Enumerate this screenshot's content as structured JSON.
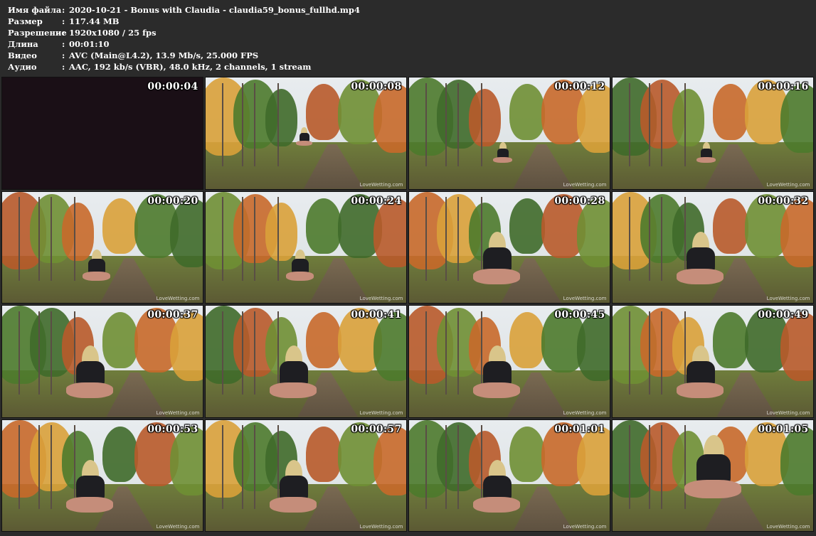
{
  "info": [
    {
      "key": "Имя файла",
      "value": "2020-10-21 - Bonus with Claudia - claudia59_bonus_fullhd.mp4"
    },
    {
      "key": "Размер",
      "value": "117.44 MB"
    },
    {
      "key": "Разрешение",
      "value": "1920x1080 / 25 fps"
    },
    {
      "key": "Длина",
      "value": "00:01:10"
    },
    {
      "key": "Видео",
      "value": "AVC (Main@L4.2), 13.9 Mb/s, 25.000 FPS"
    },
    {
      "key": "Аудио",
      "value": "AAC, 192 kb/s (VBR), 48.0 kHz, 2 channels, 1 stream"
    }
  ],
  "separator": ":",
  "watermark": "LoveWetting.com",
  "thumbnails": [
    {
      "time": "00:00:04",
      "scene": "dark"
    },
    {
      "time": "00:00:08",
      "scene": "standing-far"
    },
    {
      "time": "00:00:12",
      "scene": "squat-far"
    },
    {
      "time": "00:00:16",
      "scene": "squat-far"
    },
    {
      "time": "00:00:20",
      "scene": "squat-mid"
    },
    {
      "time": "00:00:24",
      "scene": "squat-mid"
    },
    {
      "time": "00:00:28",
      "scene": "squat-close"
    },
    {
      "time": "00:00:32",
      "scene": "squat-close"
    },
    {
      "time": "00:00:37",
      "scene": "squat-close"
    },
    {
      "time": "00:00:41",
      "scene": "squat-close"
    },
    {
      "time": "00:00:45",
      "scene": "squat-close"
    },
    {
      "time": "00:00:49",
      "scene": "squat-close"
    },
    {
      "time": "00:00:53",
      "scene": "squat-close"
    },
    {
      "time": "00:00:57",
      "scene": "squat-close"
    },
    {
      "time": "00:01:01",
      "scene": "squat-close"
    },
    {
      "time": "00:01:05",
      "scene": "standing-near"
    }
  ]
}
